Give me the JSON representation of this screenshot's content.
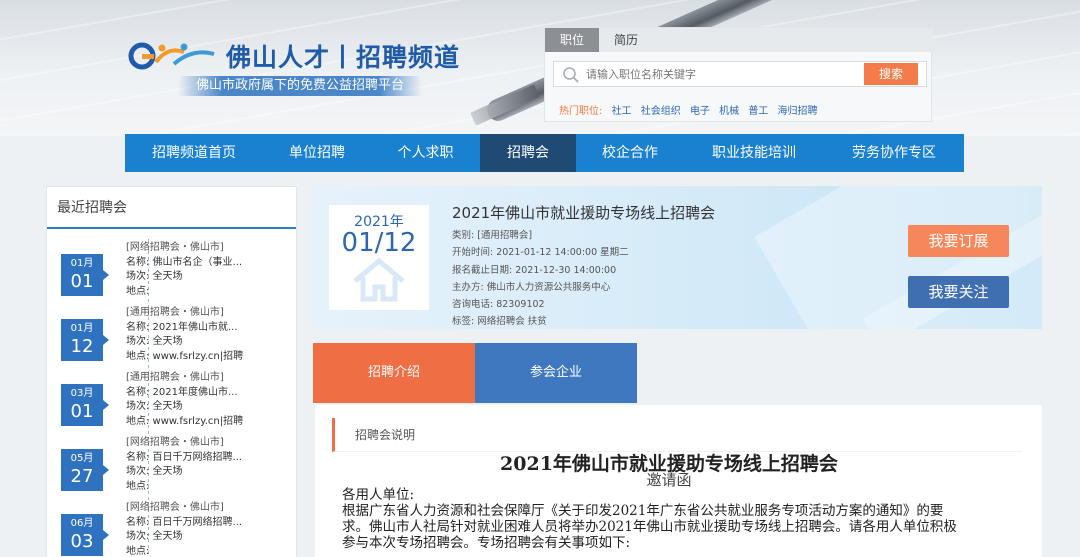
{
  "brand": {
    "title": "佛山人才丨招聘频道",
    "subtitle": "佛山市政府属下的免费公益招聘平台",
    "colors": {
      "primary": "#1a80d0",
      "accent": "#f06e43",
      "dark_nav": "#1e4a73"
    }
  },
  "search": {
    "tabs": [
      "职位",
      "简历"
    ],
    "active_tab": "职位",
    "placeholder": "请输入职位名称关键字",
    "button": "搜索",
    "hot_label": "热门职位:",
    "hot_items": [
      "社工",
      "社会组织",
      "电子",
      "机械",
      "普工",
      "海归招聘"
    ]
  },
  "nav": {
    "items": [
      "招聘频道首页",
      "单位招聘",
      "个人求职",
      "招聘会",
      "校企合作",
      "职业技能培训",
      "劳务协作专区"
    ],
    "active": "招聘会"
  },
  "sidebar": {
    "title": "最近招聘会",
    "events": [
      {
        "month": "01月",
        "day": "01",
        "tag": "[网络招聘会・佛山市]",
        "name": "名称: 佛山市名企（事业...",
        "venue": "场次: 全天场",
        "place": "地点:"
      },
      {
        "month": "01月",
        "day": "12",
        "tag": "[通用招聘会・佛山市]",
        "name": "名称: 2021年佛山市就...",
        "venue": "场次: 全天场",
        "place": "地点: www.fsrlzy.cn|招聘"
      },
      {
        "month": "03月",
        "day": "01",
        "tag": "[通用招聘会・佛山市]",
        "name": "名称: 2021年度佛山市...",
        "venue": "场次: 全天场",
        "place": "地点: www.fsrlzy.cn|招聘"
      },
      {
        "month": "05月",
        "day": "27",
        "tag": "[网络招聘会・佛山市]",
        "name": "名称: 百日千万网络招聘...",
        "venue": "场次: 全天场",
        "place": "地点:"
      },
      {
        "month": "06月",
        "day": "03",
        "tag": "[网络招聘会・佛山市]",
        "name": "名称: 百日千万网络招聘...",
        "venue": "场次: 全天场",
        "place": "地点:"
      }
    ]
  },
  "fair": {
    "year": "2021年",
    "date": "01/12",
    "title": "2021年佛山市就业援助专场线上招聘会",
    "category": "类别: [通用招聘会]",
    "start_time": "开始时间: 2021-01-12 14:00:00   星期二",
    "deadline": "报名截止日期: 2021-12-30 14:00:00",
    "organizer": "主办方: 佛山市人力资源公共服务中心",
    "phone": "咨询电话: 82309102",
    "tags": "标签: 网络招聘会      扶贫",
    "subscribe_button": "我要订展",
    "follow_button": "我要关注"
  },
  "content_tabs": [
    "招聘介绍",
    "参会企业"
  ],
  "content": {
    "section_label": "招聘会说明",
    "doc_title": "2021年佛山市就业援助专场线上招聘会",
    "doc_subtitle": "邀请函",
    "greeting": "各用人单位:",
    "line1": "根据广东省人力资源和社会保障厅《关于印发2021年广东省公共就业服务专项活动方案的通知》的要",
    "line2": "求。佛山市人社局针对就业困难人员将举办2021年佛山市就业援助专场线上招聘会。请各用人单位积极",
    "line3": "参与本次专场招聘会。专场招聘会有关事项如下:"
  }
}
